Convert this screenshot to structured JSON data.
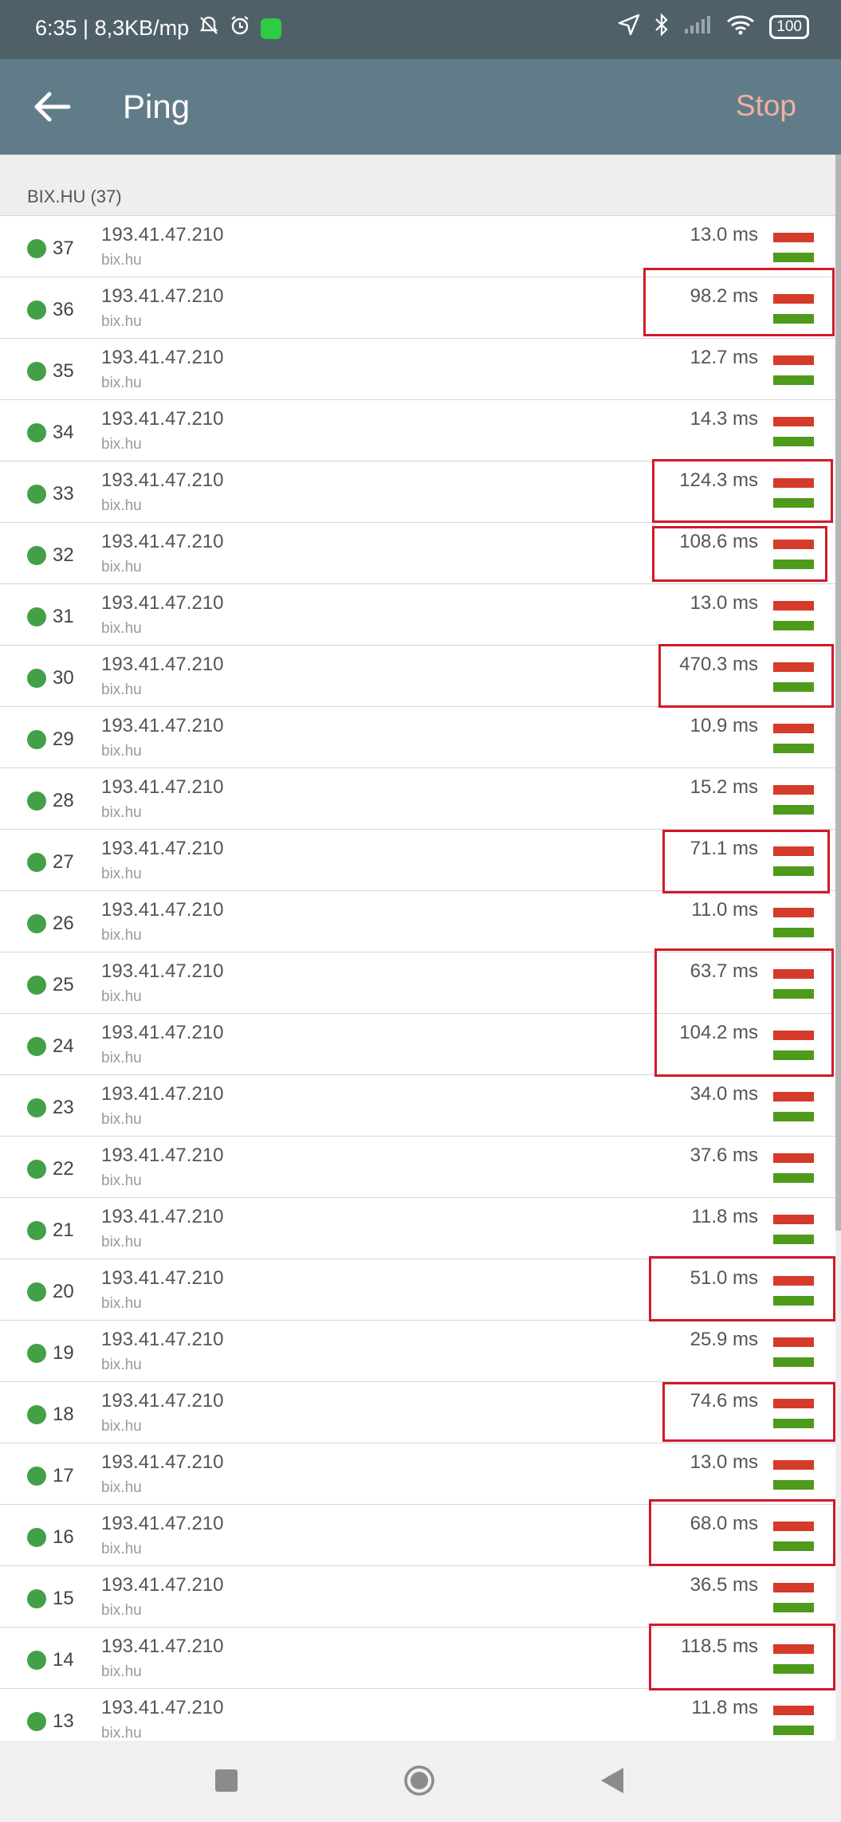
{
  "status_bar": {
    "time_speed": "6:35 | 8,3KB/mp",
    "battery": "100",
    "icons": [
      "mute-icon",
      "alarm-icon",
      "app-badge-icon",
      "location-icon",
      "bluetooth-icon",
      "signal-icon",
      "wifi-icon",
      "battery-icon"
    ]
  },
  "app_bar": {
    "title": "Ping",
    "stop_label": "Stop",
    "back_icon": "back-arrow-icon"
  },
  "section": {
    "header": "BIX.HU (37)"
  },
  "colors": {
    "status_dot": "#43a047",
    "bar_red": "#d53a2a",
    "bar_green": "#4e9a1a",
    "highlight": "#d11a2a",
    "appbar": "#617c89",
    "stop": "#f2b0a1"
  },
  "rows": [
    {
      "seq": "37",
      "ip": "193.41.47.210",
      "host": "bix.hu",
      "time": "13.0 ms"
    },
    {
      "seq": "36",
      "ip": "193.41.47.210",
      "host": "bix.hu",
      "time": "98.2 ms"
    },
    {
      "seq": "35",
      "ip": "193.41.47.210",
      "host": "bix.hu",
      "time": "12.7 ms"
    },
    {
      "seq": "34",
      "ip": "193.41.47.210",
      "host": "bix.hu",
      "time": "14.3 ms"
    },
    {
      "seq": "33",
      "ip": "193.41.47.210",
      "host": "bix.hu",
      "time": "124.3 ms"
    },
    {
      "seq": "32",
      "ip": "193.41.47.210",
      "host": "bix.hu",
      "time": "108.6 ms"
    },
    {
      "seq": "31",
      "ip": "193.41.47.210",
      "host": "bix.hu",
      "time": "13.0 ms"
    },
    {
      "seq": "30",
      "ip": "193.41.47.210",
      "host": "bix.hu",
      "time": "470.3 ms"
    },
    {
      "seq": "29",
      "ip": "193.41.47.210",
      "host": "bix.hu",
      "time": "10.9 ms"
    },
    {
      "seq": "28",
      "ip": "193.41.47.210",
      "host": "bix.hu",
      "time": "15.2 ms"
    },
    {
      "seq": "27",
      "ip": "193.41.47.210",
      "host": "bix.hu",
      "time": "71.1 ms"
    },
    {
      "seq": "26",
      "ip": "193.41.47.210",
      "host": "bix.hu",
      "time": "11.0 ms"
    },
    {
      "seq": "25",
      "ip": "193.41.47.210",
      "host": "bix.hu",
      "time": "63.7 ms"
    },
    {
      "seq": "24",
      "ip": "193.41.47.210",
      "host": "bix.hu",
      "time": "104.2 ms"
    },
    {
      "seq": "23",
      "ip": "193.41.47.210",
      "host": "bix.hu",
      "time": "34.0 ms"
    },
    {
      "seq": "22",
      "ip": "193.41.47.210",
      "host": "bix.hu",
      "time": "37.6 ms"
    },
    {
      "seq": "21",
      "ip": "193.41.47.210",
      "host": "bix.hu",
      "time": "11.8 ms"
    },
    {
      "seq": "20",
      "ip": "193.41.47.210",
      "host": "bix.hu",
      "time": "51.0 ms"
    },
    {
      "seq": "19",
      "ip": "193.41.47.210",
      "host": "bix.hu",
      "time": "25.9 ms"
    },
    {
      "seq": "18",
      "ip": "193.41.47.210",
      "host": "bix.hu",
      "time": "74.6 ms"
    },
    {
      "seq": "17",
      "ip": "193.41.47.210",
      "host": "bix.hu",
      "time": "13.0 ms"
    },
    {
      "seq": "16",
      "ip": "193.41.47.210",
      "host": "bix.hu",
      "time": "68.0 ms"
    },
    {
      "seq": "15",
      "ip": "193.41.47.210",
      "host": "bix.hu",
      "time": "36.5 ms"
    },
    {
      "seq": "14",
      "ip": "193.41.47.210",
      "host": "bix.hu",
      "time": "118.5 ms"
    },
    {
      "seq": "13",
      "ip": "193.41.47.210",
      "host": "bix.hu",
      "time": "11.8 ms"
    }
  ],
  "nav_bar": {
    "icons": [
      "recent-apps-icon",
      "home-icon",
      "back-icon"
    ]
  }
}
